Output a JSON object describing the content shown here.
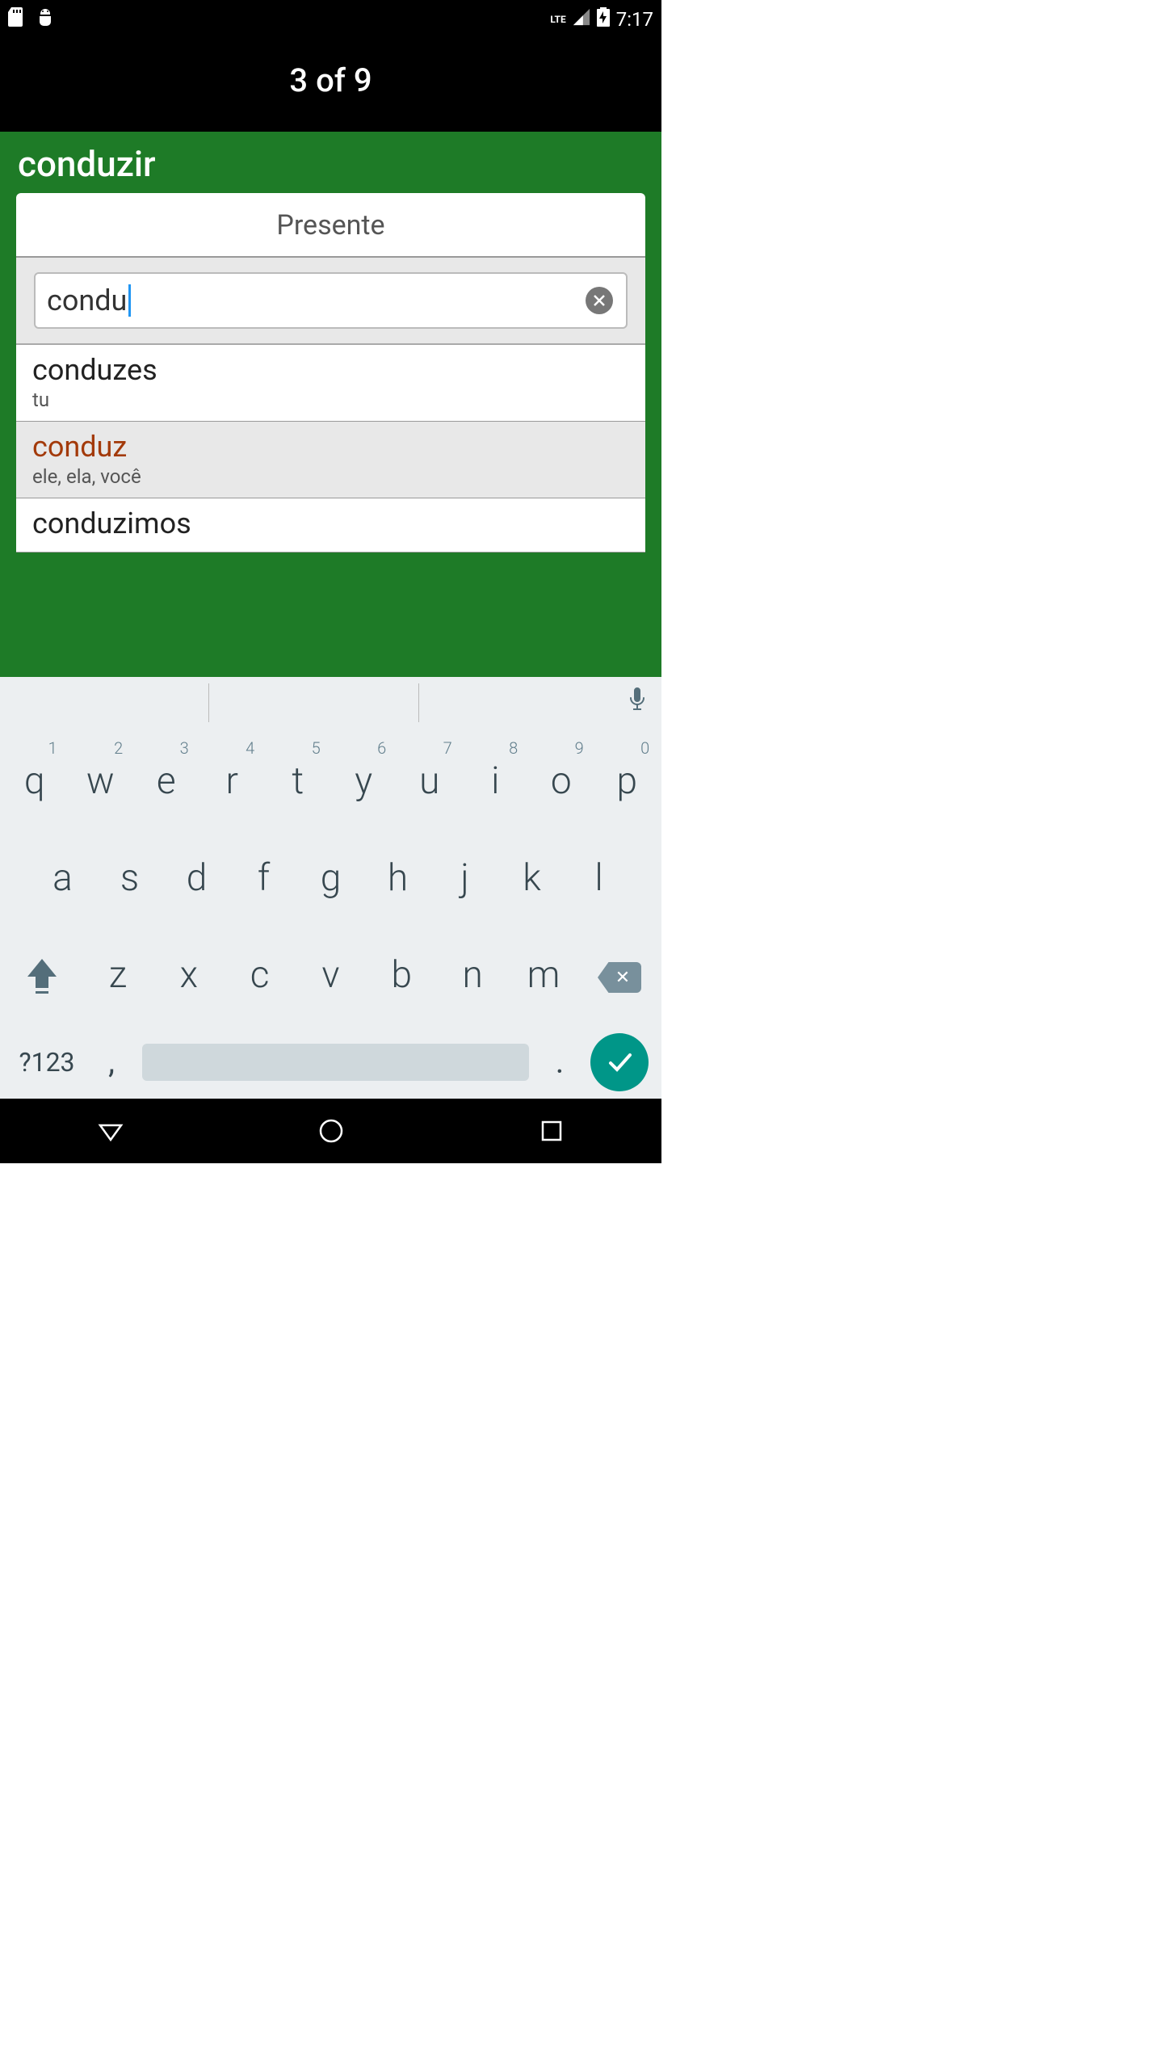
{
  "status": {
    "time": "7:17",
    "lte": "LTE"
  },
  "header": {
    "counter": "3 of 9"
  },
  "page": {
    "verb": "conduzir",
    "tense": "Presente",
    "input_value": "condu"
  },
  "conjugations": [
    {
      "word": "conduzes",
      "pronoun": "tu",
      "selected": false
    },
    {
      "word": "conduz",
      "pronoun": "ele, ela, você",
      "selected": true
    },
    {
      "word": "conduzimos",
      "pronoun": "",
      "selected": false
    }
  ],
  "keyboard": {
    "row1": [
      {
        "k": "q",
        "n": "1"
      },
      {
        "k": "w",
        "n": "2"
      },
      {
        "k": "e",
        "n": "3"
      },
      {
        "k": "r",
        "n": "4"
      },
      {
        "k": "t",
        "n": "5"
      },
      {
        "k": "y",
        "n": "6"
      },
      {
        "k": "u",
        "n": "7"
      },
      {
        "k": "i",
        "n": "8"
      },
      {
        "k": "o",
        "n": "9"
      },
      {
        "k": "p",
        "n": "0"
      }
    ],
    "row2": [
      "a",
      "s",
      "d",
      "f",
      "g",
      "h",
      "j",
      "k",
      "l"
    ],
    "row3": [
      "z",
      "x",
      "c",
      "v",
      "b",
      "n",
      "m"
    ],
    "symbols": "?123",
    "comma": ",",
    "period": "."
  }
}
